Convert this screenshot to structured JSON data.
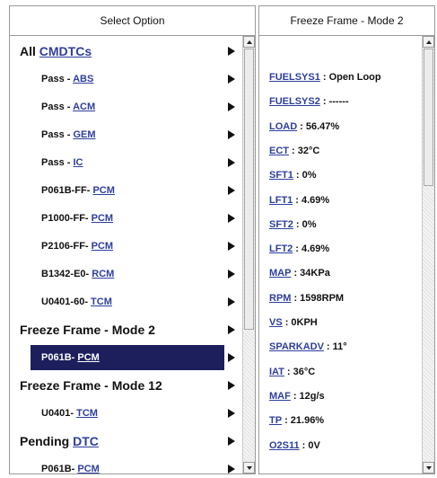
{
  "left_panel": {
    "header": "Select Option",
    "rows": [
      {
        "prefix": "All ",
        "link": "CMDTCs",
        "kind": "section"
      },
      {
        "prefix": "Pass - ",
        "link": "ABS",
        "kind": "item"
      },
      {
        "prefix": "Pass - ",
        "link": "ACM",
        "kind": "item"
      },
      {
        "prefix": "Pass - ",
        "link": "GEM",
        "kind": "item"
      },
      {
        "prefix": "Pass - ",
        "link": "IC",
        "kind": "item"
      },
      {
        "prefix": "P061B-FF- ",
        "link": "PCM",
        "kind": "item"
      },
      {
        "prefix": "P1000-FF- ",
        "link": "PCM",
        "kind": "item"
      },
      {
        "prefix": "P2106-FF- ",
        "link": "PCM",
        "kind": "item"
      },
      {
        "prefix": "B1342-E0- ",
        "link": "RCM",
        "kind": "item"
      },
      {
        "prefix": "U0401-60- ",
        "link": "TCM",
        "kind": "item"
      },
      {
        "prefix": "Freeze Frame - Mode 2",
        "link": "",
        "kind": "section"
      },
      {
        "prefix": "P061B- ",
        "link": "PCM",
        "kind": "item",
        "selected": true
      },
      {
        "prefix": "Freeze Frame - Mode 12",
        "link": "",
        "kind": "section"
      },
      {
        "prefix": "U0401- ",
        "link": "TCM",
        "kind": "item"
      },
      {
        "prefix": "Pending ",
        "link": "DTC",
        "kind": "section"
      },
      {
        "prefix": "P061B- ",
        "link": "PCM",
        "kind": "item"
      }
    ]
  },
  "right_panel": {
    "header": "Freeze Frame - Mode 2",
    "params": [
      {
        "name": "FUELSYS1",
        "value": ": Open Loop"
      },
      {
        "name": "FUELSYS2",
        "value": ": ------"
      },
      {
        "name": "LOAD",
        "value": ": 56.47%"
      },
      {
        "name": "ECT",
        "value": ": 32°C"
      },
      {
        "name": "SFT1",
        "value": ": 0%"
      },
      {
        "name": "LFT1",
        "value": ": 4.69%"
      },
      {
        "name": "SFT2",
        "value": ": 0%"
      },
      {
        "name": "LFT2",
        "value": ": 4.69%"
      },
      {
        "name": "MAP",
        "value": ": 34KPa"
      },
      {
        "name": "RPM",
        "value": ": 1598RPM"
      },
      {
        "name": "VS",
        "value": ": 0KPH"
      },
      {
        "name": "SPARKADV",
        "value": ": 11°"
      },
      {
        "name": "IAT",
        "value": ": 36°C"
      },
      {
        "name": "MAF",
        "value": ": 12g/s"
      },
      {
        "name": "TP",
        "value": ": 21.96%"
      },
      {
        "name": "O2S11",
        "value": ": 0V"
      }
    ]
  },
  "colors": {
    "link": "#2d3e9e",
    "selected_bg": "#1c1f5c",
    "border": "#9a9a9a"
  },
  "icons": {
    "row_arrow": "right-triangle-arrow-icon",
    "scroll_up": "scroll-up-arrow-icon",
    "scroll_down": "scroll-down-arrow-icon"
  }
}
